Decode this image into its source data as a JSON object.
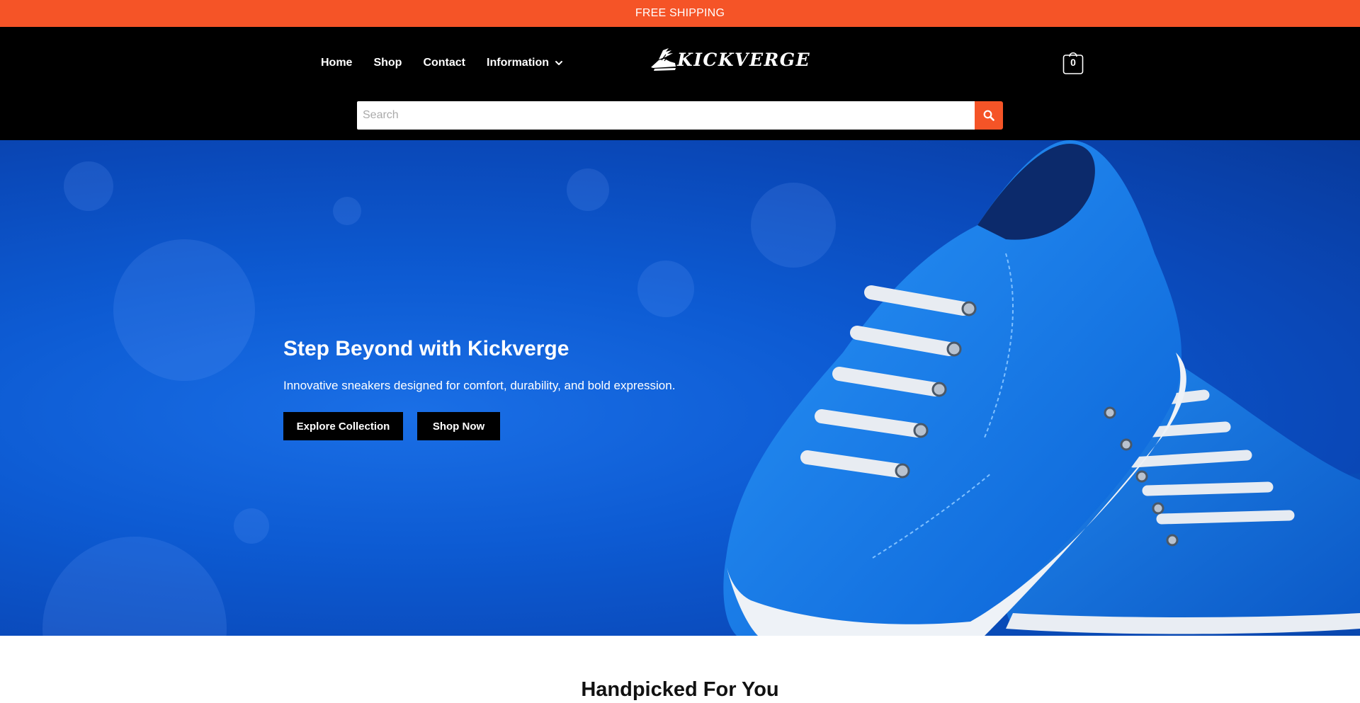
{
  "announcement": {
    "text": "FREE SHIPPING"
  },
  "nav": {
    "items": [
      {
        "label": "Home"
      },
      {
        "label": "Shop"
      },
      {
        "label": "Contact"
      },
      {
        "label": "Information",
        "has_dropdown": true
      }
    ]
  },
  "logo": {
    "text": "KICKVERGE",
    "icon": "winged-shoe-icon"
  },
  "cart": {
    "count": "0",
    "icon": "shopping-bag-icon"
  },
  "search": {
    "placeholder": "Search",
    "value": "",
    "icon": "search-icon"
  },
  "hero": {
    "title": "Step Beyond with Kickverge",
    "subtitle": "Innovative sneakers designed for comfort, durability, and bold expression.",
    "buttons": [
      {
        "label": "Explore Collection"
      },
      {
        "label": "Shop Now"
      }
    ]
  },
  "section": {
    "title": "Handpicked For You"
  },
  "colors": {
    "accent": "#f55427",
    "header_bg": "#000000",
    "hero_blue": "#0d5bd3",
    "sneaker_blue": "#1a86f0",
    "lace_white": "#e8ecf2"
  }
}
